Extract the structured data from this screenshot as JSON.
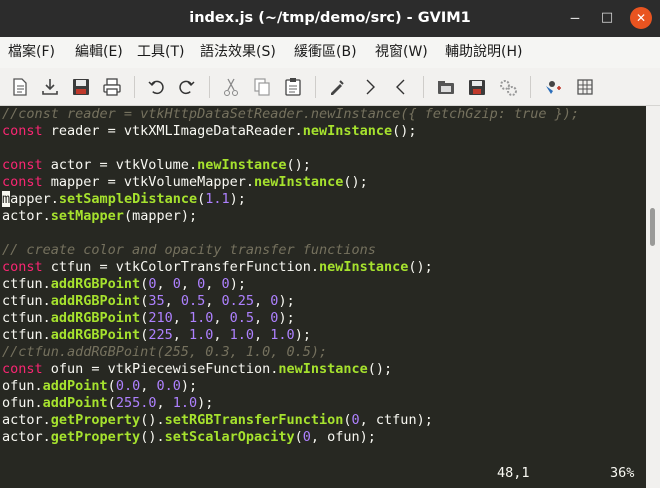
{
  "window": {
    "title": "index.js (~/tmp/demo/src) - GVIM1",
    "minimize_glyph": "‒",
    "maximize_glyph": "□",
    "close_glyph": "✕"
  },
  "menu": [
    "檔案(F)",
    "編輯(E)",
    "工具(T)",
    "語法效果(S)",
    "緩衝區(B)",
    "視窗(W)",
    "輔助說明(H)"
  ],
  "toolbar_icons": [
    "open-file-icon",
    "save-icon",
    "save-all-icon",
    "print-icon",
    "undo-icon",
    "redo-icon",
    "cut-icon",
    "copy-icon",
    "paste-icon",
    "find-replace-icon",
    "find-next-icon",
    "find-previous-icon",
    "load-session-icon",
    "save-session-icon",
    "run-script-icon",
    "make-icon",
    "ctags-icon"
  ],
  "editor": {
    "colors": {
      "background": "#272822",
      "comment": "#75715e",
      "keyword": "#f92672",
      "function": "#a6e22e",
      "number": "#ae81ff",
      "text": "#f8f8f2"
    },
    "lines": [
      [
        {
          "t": "//const reader = vtkHttpDataSetReader.newInstance({ fetchGzip: true });",
          "c": "c"
        }
      ],
      [
        {
          "t": "const",
          "c": "k"
        },
        {
          "t": " reader = vtkXMLImageDataReader."
        },
        {
          "t": "newInstance",
          "c": "f"
        },
        {
          "t": "();"
        }
      ],
      [],
      [
        {
          "t": "const",
          "c": "k"
        },
        {
          "t": " actor = vtkVolume."
        },
        {
          "t": "newInstance",
          "c": "f"
        },
        {
          "t": "();"
        }
      ],
      [
        {
          "t": "const",
          "c": "k"
        },
        {
          "t": " mapper = vtkVolumeMapper."
        },
        {
          "t": "newInstance",
          "c": "f"
        },
        {
          "t": "();"
        }
      ],
      [
        {
          "t": "m",
          "c": "cur"
        },
        {
          "t": "apper."
        },
        {
          "t": "setSampleDistance",
          "c": "f"
        },
        {
          "t": "("
        },
        {
          "t": "1.1",
          "c": "n"
        },
        {
          "t": ");"
        }
      ],
      [
        {
          "t": "actor."
        },
        {
          "t": "setMapper",
          "c": "f"
        },
        {
          "t": "(mapper);"
        }
      ],
      [],
      [
        {
          "t": "// create color and opacity transfer functions",
          "c": "c"
        }
      ],
      [
        {
          "t": "const",
          "c": "k"
        },
        {
          "t": " ctfun = vtkColorTransferFunction."
        },
        {
          "t": "newInstance",
          "c": "f"
        },
        {
          "t": "();"
        }
      ],
      [
        {
          "t": "ctfun."
        },
        {
          "t": "addRGBPoint",
          "c": "f"
        },
        {
          "t": "("
        },
        {
          "t": "0",
          "c": "n"
        },
        {
          "t": ", "
        },
        {
          "t": "0",
          "c": "n"
        },
        {
          "t": ", "
        },
        {
          "t": "0",
          "c": "n"
        },
        {
          "t": ", "
        },
        {
          "t": "0",
          "c": "n"
        },
        {
          "t": ");"
        }
      ],
      [
        {
          "t": "ctfun."
        },
        {
          "t": "addRGBPoint",
          "c": "f"
        },
        {
          "t": "("
        },
        {
          "t": "35",
          "c": "n"
        },
        {
          "t": ", "
        },
        {
          "t": "0.5",
          "c": "n"
        },
        {
          "t": ", "
        },
        {
          "t": "0.25",
          "c": "n"
        },
        {
          "t": ", "
        },
        {
          "t": "0",
          "c": "n"
        },
        {
          "t": ");"
        }
      ],
      [
        {
          "t": "ctfun."
        },
        {
          "t": "addRGBPoint",
          "c": "f"
        },
        {
          "t": "("
        },
        {
          "t": "210",
          "c": "n"
        },
        {
          "t": ", "
        },
        {
          "t": "1.0",
          "c": "n"
        },
        {
          "t": ", "
        },
        {
          "t": "0.5",
          "c": "n"
        },
        {
          "t": ", "
        },
        {
          "t": "0",
          "c": "n"
        },
        {
          "t": ");"
        }
      ],
      [
        {
          "t": "ctfun."
        },
        {
          "t": "addRGBPoint",
          "c": "f"
        },
        {
          "t": "("
        },
        {
          "t": "225",
          "c": "n"
        },
        {
          "t": ", "
        },
        {
          "t": "1.0",
          "c": "n"
        },
        {
          "t": ", "
        },
        {
          "t": "1.0",
          "c": "n"
        },
        {
          "t": ", "
        },
        {
          "t": "1.0",
          "c": "n"
        },
        {
          "t": ");"
        }
      ],
      [
        {
          "t": "//ctfun.addRGBPoint(255, 0.3, 1.0, 0.5);",
          "c": "c"
        }
      ],
      [
        {
          "t": "const",
          "c": "k"
        },
        {
          "t": " ofun = vtkPiecewiseFunction."
        },
        {
          "t": "newInstance",
          "c": "f"
        },
        {
          "t": "();"
        }
      ],
      [
        {
          "t": "ofun."
        },
        {
          "t": "addPoint",
          "c": "f"
        },
        {
          "t": "("
        },
        {
          "t": "0.0",
          "c": "n"
        },
        {
          "t": ", "
        },
        {
          "t": "0.0",
          "c": "n"
        },
        {
          "t": ");"
        }
      ],
      [
        {
          "t": "ofun."
        },
        {
          "t": "addPoint",
          "c": "f"
        },
        {
          "t": "("
        },
        {
          "t": "255.0",
          "c": "n"
        },
        {
          "t": ", "
        },
        {
          "t": "1.0",
          "c": "n"
        },
        {
          "t": ");"
        }
      ],
      [
        {
          "t": "actor."
        },
        {
          "t": "getProperty",
          "c": "f"
        },
        {
          "t": "()."
        },
        {
          "t": "setRGBTransferFunction",
          "c": "f"
        },
        {
          "t": "("
        },
        {
          "t": "0",
          "c": "n"
        },
        {
          "t": ", ctfun);"
        }
      ],
      [
        {
          "t": "actor."
        },
        {
          "t": "getProperty",
          "c": "f"
        },
        {
          "t": "()."
        },
        {
          "t": "setScalarOpacity",
          "c": "f"
        },
        {
          "t": "("
        },
        {
          "t": "0",
          "c": "n"
        },
        {
          "t": ", ofun);"
        }
      ]
    ]
  },
  "status": {
    "position": "48,1",
    "percent": "36%"
  },
  "scroll_fraction": 0.36
}
